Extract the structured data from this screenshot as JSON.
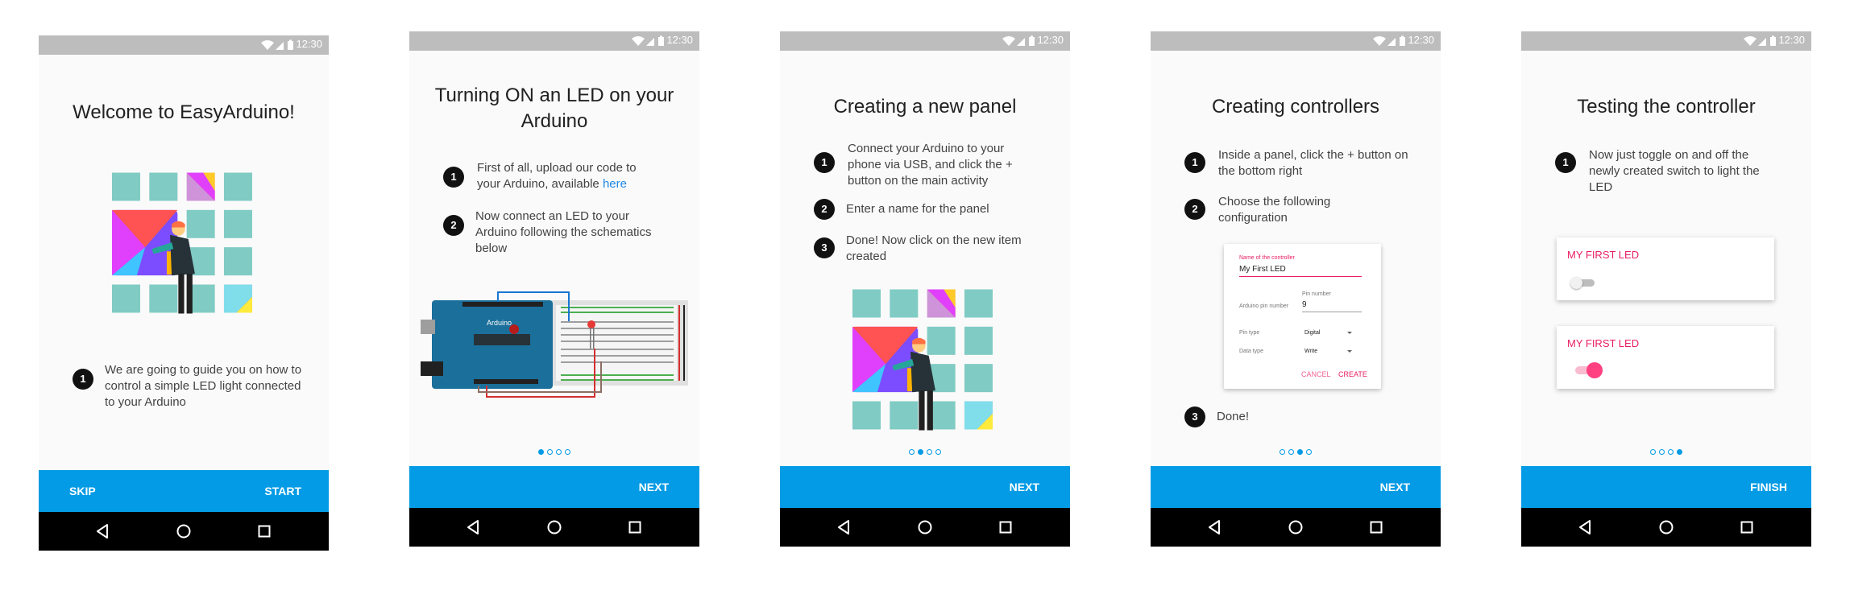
{
  "status_time": "12:30",
  "colors": {
    "accent": "#039be5",
    "pink": "#ff4081",
    "status": "#bdbdbd",
    "nav": "#000000"
  },
  "screens": [
    {
      "title": "Welcome to EasyArduino!",
      "steps": [
        {
          "num": "1",
          "text": "We are going to guide you on how to control a simple LED light connected to your Arduino"
        }
      ],
      "skip_label": "SKIP",
      "action_label": "START"
    },
    {
      "title": "Turning ON an LED on your Arduino",
      "steps": [
        {
          "num": "1",
          "text": "First of all, upload our code to your Arduino, available ",
          "link": "here"
        },
        {
          "num": "2",
          "text": "Now connect an LED to your Arduino following the schematics below"
        }
      ],
      "board_label": "Arduino",
      "action_label": "NEXT"
    },
    {
      "title": "Creating a new panel",
      "steps": [
        {
          "num": "1",
          "text": "Connect your Arduino to your phone via USB, and click the + button on the main activity"
        },
        {
          "num": "2",
          "text": "Enter a name for the panel"
        },
        {
          "num": "3",
          "text": "Done! Now click on the new item created"
        }
      ],
      "action_label": "NEXT"
    },
    {
      "title": "Creating controllers",
      "steps": [
        {
          "num": "1",
          "text": "Inside a panel, click the + button on the bottom right"
        },
        {
          "num": "2",
          "text": "Choose the following configuration"
        },
        {
          "num": "3",
          "text": "Done!"
        }
      ],
      "form": {
        "name_label": "Name of the controller",
        "name_value": "My First LED",
        "pin_label": "Arduino pin number",
        "pin_float": "Pin number",
        "pin_value": "9",
        "pin_type_label": "Pin type",
        "pin_type_value": "Digital",
        "data_type_label": "Data type",
        "data_type_value": "Write",
        "cancel": "CANCEL",
        "create": "CREATE"
      },
      "action_label": "NEXT"
    },
    {
      "title": "Testing the controller",
      "steps": [
        {
          "num": "1",
          "text": "Now just toggle on and off the newly created switch to light the LED"
        }
      ],
      "cards": [
        {
          "title": "MY FIRST LED",
          "switch_on": false
        },
        {
          "title": "MY FIRST LED",
          "switch_on": true
        }
      ],
      "action_label": "FINISH"
    }
  ]
}
